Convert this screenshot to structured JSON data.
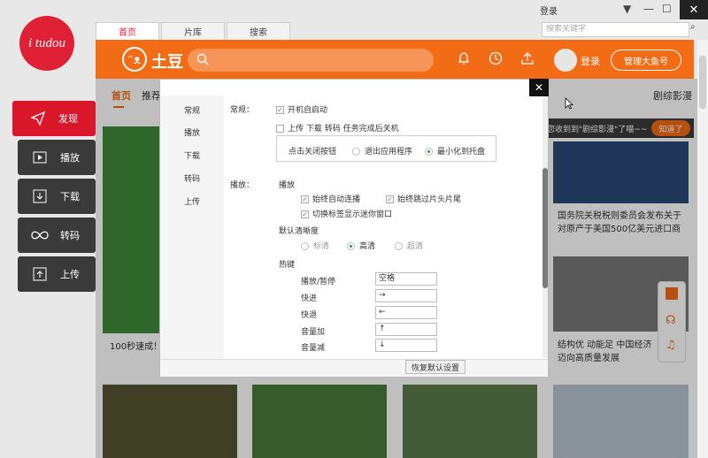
{
  "app": {
    "logo_text": "i tudou",
    "rail": [
      {
        "label": "发现",
        "icon": "send-icon"
      },
      {
        "label": "播放",
        "icon": "play-icon"
      },
      {
        "label": "下载",
        "icon": "download-icon"
      },
      {
        "label": "转码",
        "icon": "infinity-icon"
      },
      {
        "label": "上传",
        "icon": "upload-icon"
      }
    ],
    "tabs": [
      "首页",
      "片库",
      "搜索"
    ],
    "login": "登录",
    "search_placeholder": "搜索关键字"
  },
  "header": {
    "brand": "土豆",
    "login": "登录",
    "manage_button": "管理大鱼号"
  },
  "content": {
    "nav": [
      "首页",
      "推荐"
    ],
    "nav_right": "剧综影漫",
    "tip_text": "您收到到\"剧综影漫\"了喵~~",
    "tip_button": "知道了",
    "captions": {
      "left": "100秒速成！",
      "right_top": "国务院关税税则委员会发布关于对原产于美国500亿美元进口商",
      "right_mid": "结构优 动能足 中国经济迈向高质量发展"
    }
  },
  "settings": {
    "sidebar": [
      "常规",
      "播放",
      "下载",
      "转码",
      "上传"
    ],
    "general": {
      "section": "常规：",
      "autostart": "开机自启动",
      "shutdown": "上传 下载 转码 任务完成后关机",
      "close_label": "点击关闭按钮",
      "close_options": [
        "退出应用程序",
        "最小化到托盘"
      ]
    },
    "play": {
      "section": "播放：",
      "subsection": "播放",
      "auto_continue": "始终自动连播",
      "skip_intro": "始终跳过片头片尾",
      "mini_window": "切换标签显示迷你窗口",
      "quality_title": "默认清晰度",
      "quality_options": [
        "标清",
        "高清",
        "超清"
      ]
    },
    "hotkeys": {
      "title": "热键",
      "items": [
        {
          "action": "播放/暂停",
          "key": "空格"
        },
        {
          "action": "快进",
          "key": "→"
        },
        {
          "action": "快退",
          "key": "←"
        },
        {
          "action": "音量加",
          "key": "↑"
        },
        {
          "action": "音量减",
          "key": "↓"
        }
      ]
    },
    "reset_button": "恢复默认设置"
  }
}
